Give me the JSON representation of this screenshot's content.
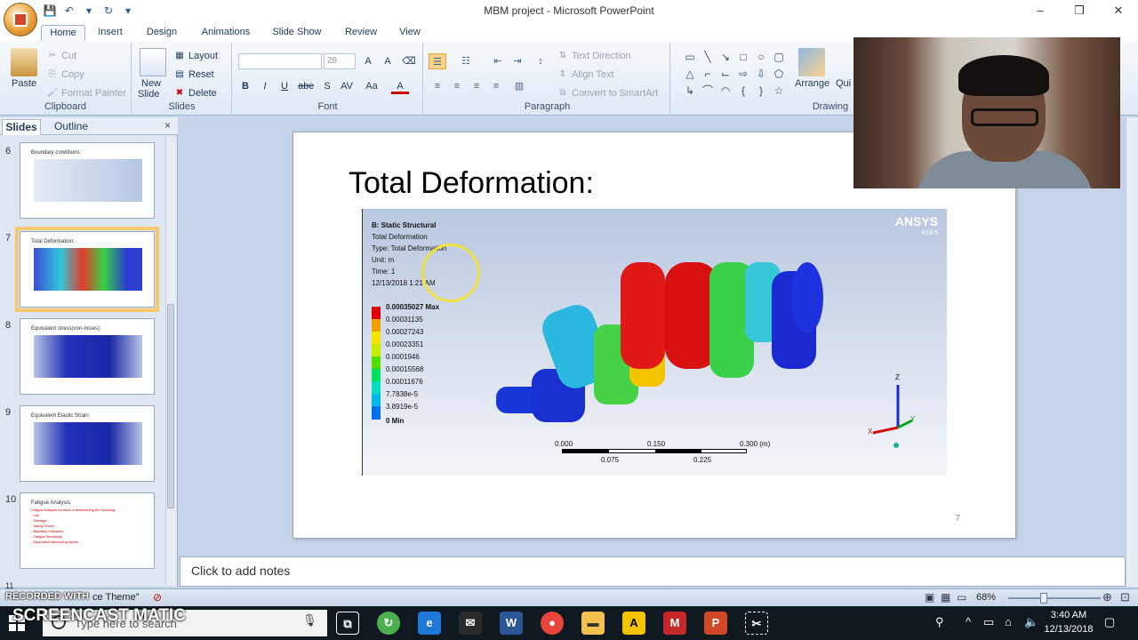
{
  "window": {
    "title": "MBM project - Microsoft PowerPoint",
    "controls": [
      "–",
      "❐",
      "✕"
    ]
  },
  "ribbon_tabs": [
    "Home",
    "Insert",
    "Design",
    "Animations",
    "Slide Show",
    "Review",
    "View"
  ],
  "ribbon": {
    "clipboard": {
      "label": "Clipboard",
      "paste": "Paste",
      "cut": "Cut",
      "copy": "Copy",
      "format_painter": "Format Painter"
    },
    "slides": {
      "label": "Slides",
      "new_slide_1": "New",
      "new_slide_2": "Slide",
      "layout": "Layout",
      "reset": "Reset",
      "delete": "Delete"
    },
    "font": {
      "label": "Font",
      "size": "28",
      "buttons": [
        "B",
        "I",
        "U",
        "abc",
        "S",
        "AV",
        "Aa",
        "A"
      ]
    },
    "paragraph": {
      "label": "Paragraph",
      "text_direction": "Text Direction",
      "align_text": "Align Text",
      "smartart": "Convert to SmartArt"
    },
    "drawing": {
      "label": "Drawing",
      "arrange": "Arrange",
      "quick_styles": "Qui Style"
    }
  },
  "slides_pane": {
    "tabs": [
      "Slides",
      "Outline"
    ],
    "thumbnails": [
      {
        "num": "6",
        "title": "Boundary conditions:"
      },
      {
        "num": "7",
        "title": "Total Deformation:"
      },
      {
        "num": "8",
        "title": "Equivalent stress(von-mises):"
      },
      {
        "num": "9",
        "title": "Equivalent Elastic Strain:"
      },
      {
        "num": "10",
        "title": "Fatigue Analysis:",
        "lines": [
          "Fatigue Analysis involves in determining the following:",
          "- Life",
          "- Damage",
          "- Safety Factor",
          "- Biaxiality Indication",
          "- Fatigue Sensitivity",
          "- Equivalent alternating stress"
        ]
      }
    ],
    "next_num": "11"
  },
  "slide": {
    "title": "Total Deformation:",
    "number": "7",
    "ansys": {
      "logo": "ANSYS",
      "version": "R14.5",
      "info": [
        "B: Static Structural",
        "Total Deformation",
        "Type: Total Deformation",
        "Unit: m",
        "Time: 1",
        "12/13/2018 1:21 AM"
      ],
      "legend": [
        "0.00035027 Max",
        "0.00031135",
        "0.00027243",
        "0.00023351",
        "0.0001946",
        "0.00015568",
        "0.00011676",
        "7.7838e-5",
        "3.8919e-5",
        "0 Min"
      ],
      "scale_top": [
        "0.000",
        "0.150",
        "0.300 (m)"
      ],
      "scale_bottom": [
        "0.075",
        "0.225"
      ],
      "axis_z": "Z",
      "axis_x": "X",
      "axis_y": "Y"
    }
  },
  "notes": {
    "placeholder": "Click to add notes"
  },
  "statusbar": {
    "theme": "ce Theme\"",
    "zoom": "68%"
  },
  "overlay": {
    "recorded": "RECORDED WITH",
    "brand": "SCREENCAST MATIC"
  },
  "taskbar": {
    "search": "Type here to search",
    "time": "3:40 AM",
    "date": "12/13/2018"
  }
}
